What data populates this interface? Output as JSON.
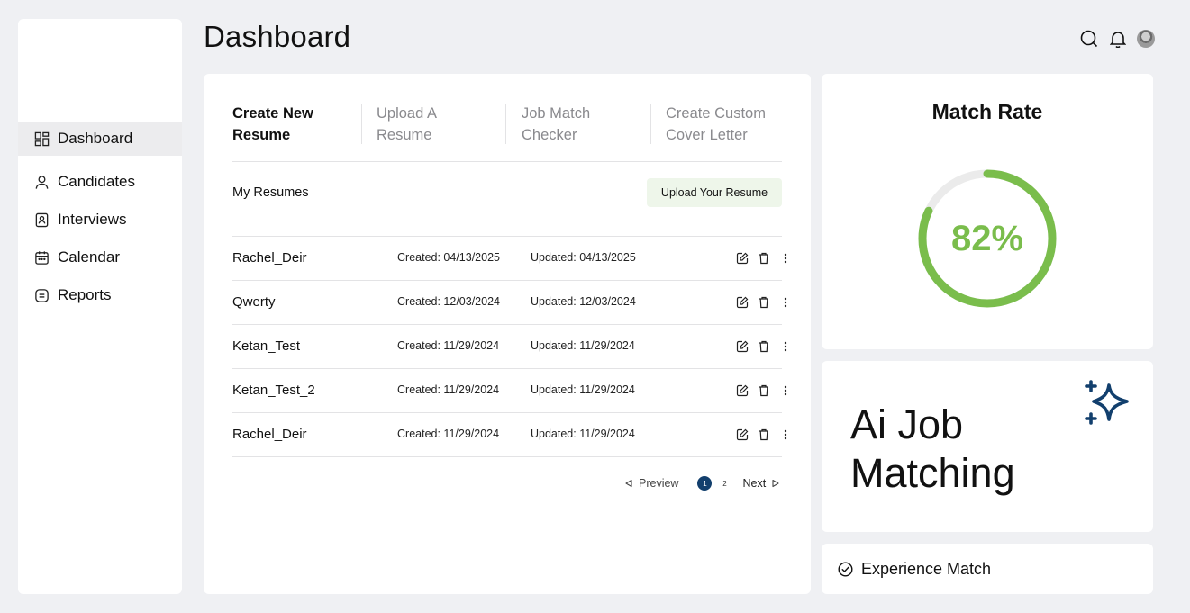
{
  "header": {
    "title": "Dashboard"
  },
  "sidebar": {
    "items": [
      {
        "label": "Dashboard",
        "icon": "grid-icon",
        "active": true
      },
      {
        "label": "Candidates",
        "icon": "user-icon"
      },
      {
        "label": "Interviews",
        "icon": "badge-icon"
      },
      {
        "label": "Calendar",
        "icon": "calendar-icon"
      },
      {
        "label": "Reports",
        "icon": "report-icon"
      }
    ]
  },
  "tabs": [
    {
      "label": "Create New\nResume",
      "active": true
    },
    {
      "label": "Upload A\nResume"
    },
    {
      "label": "Job Match\nChecker"
    },
    {
      "label": "Create Custom\nCover Letter"
    }
  ],
  "resumes": {
    "section_label": "My Resumes",
    "upload_label": "Upload Your Resume",
    "rows": [
      {
        "name": "Rachel_Deir",
        "created": "Created: 04/13/2025",
        "updated": "Updated: 04/13/2025"
      },
      {
        "name": "Qwerty",
        "created": "Created: 12/03/2024",
        "updated": "Updated: 12/03/2024"
      },
      {
        "name": "Ketan_Test",
        "created": "Created: 11/29/2024",
        "updated": "Updated: 11/29/2024"
      },
      {
        "name": "Ketan_Test_2",
        "created": "Created: 11/29/2024",
        "updated": "Updated: 11/29/2024"
      },
      {
        "name": "Rachel_Deir",
        "created": "Created: 11/29/2024",
        "updated": "Updated: 11/29/2024"
      }
    ]
  },
  "pagination": {
    "prev_label": "Preview",
    "pages": [
      "1",
      "2"
    ],
    "current": "1",
    "next_label": "Next"
  },
  "match_rate": {
    "title": "Match Rate",
    "value_label": "82%",
    "value": 82,
    "color": "#7abd4c",
    "track_color": "#ebebeb"
  },
  "ai_card": {
    "title": "Ai Job Matching",
    "icon": "sparkle-icon",
    "icon_color": "#123f6d"
  },
  "experience": {
    "label": "Experience Match",
    "icon": "check-circle-icon"
  },
  "colors": {
    "accent": "#123f6d",
    "green": "#7abd4c",
    "background": "#eff0f3"
  }
}
